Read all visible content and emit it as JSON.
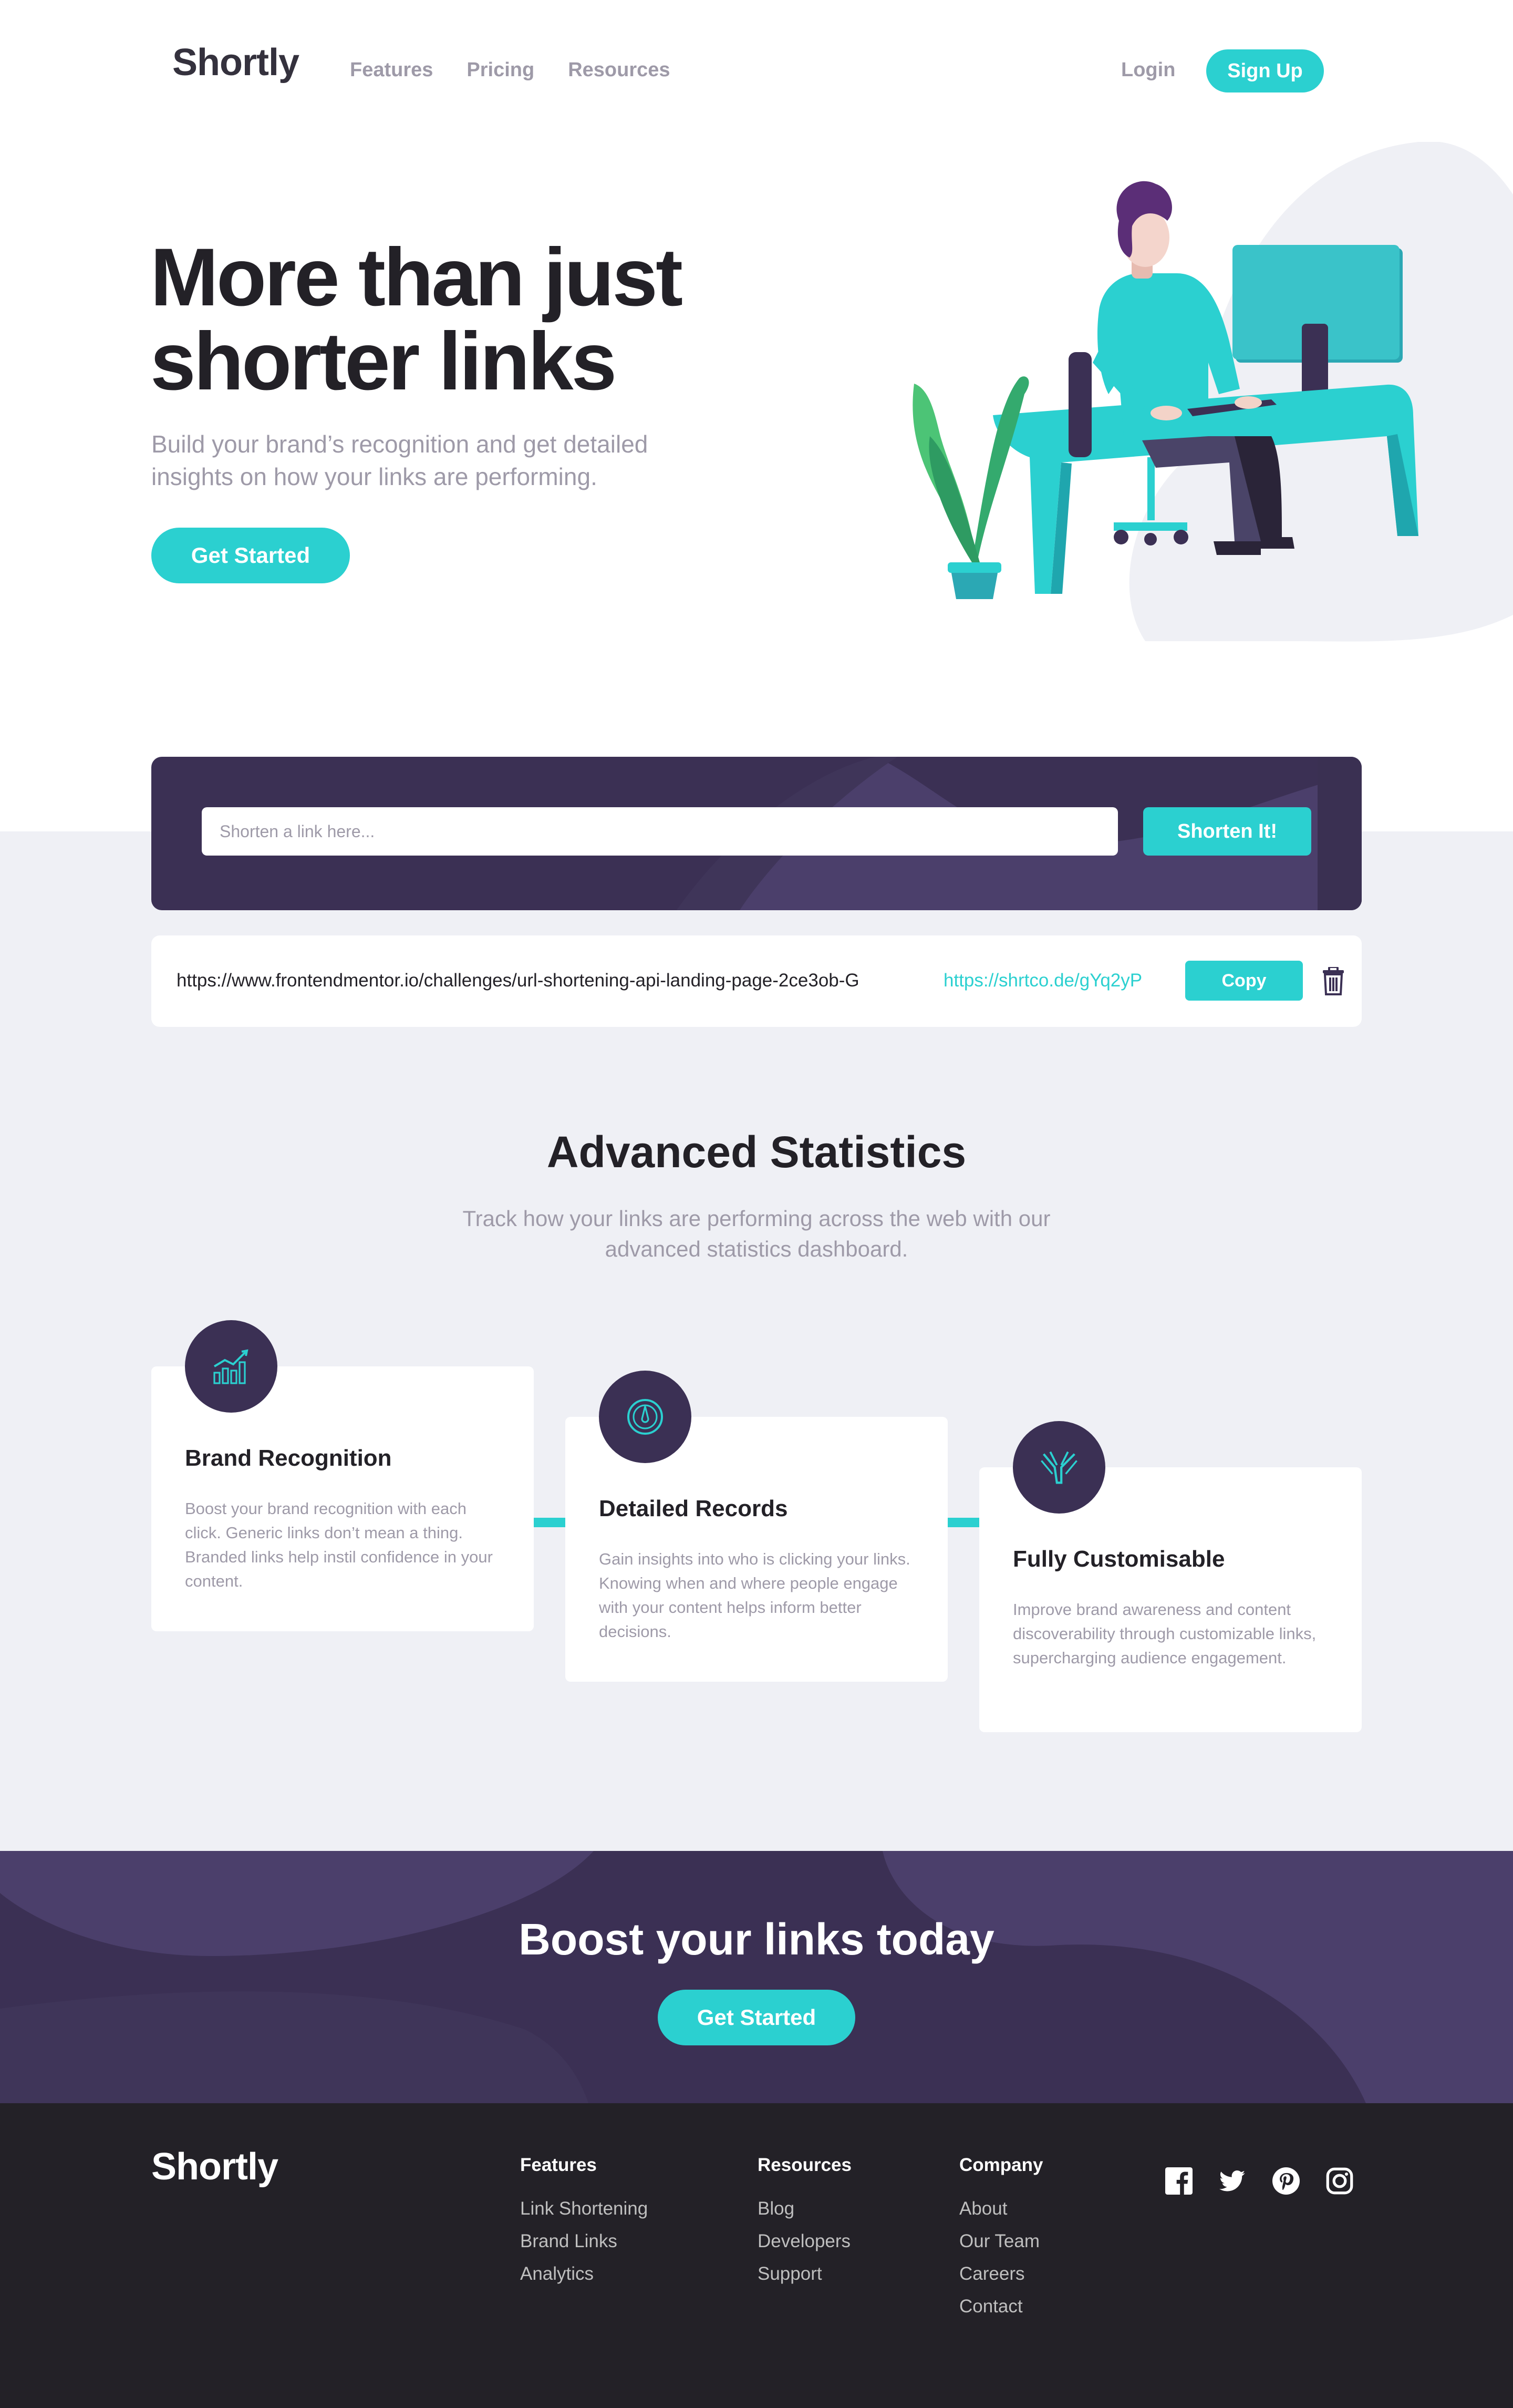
{
  "header": {
    "logo": "Shortly",
    "nav": [
      "Features",
      "Pricing",
      "Resources"
    ],
    "login_label": "Login",
    "signup_label": "Sign Up"
  },
  "hero": {
    "title_line1": "More than just",
    "title_line2": "shorter links",
    "subtitle": "Build your brand’s recognition and get detailed insights on how your links are performing.",
    "cta_label": "Get Started"
  },
  "shorten": {
    "placeholder": "Shorten a link here...",
    "button_label": "Shorten It!"
  },
  "result": {
    "original_url": "https://www.frontendmentor.io/challenges/url-shortening-api-landing-page-2ce3ob-G",
    "short_url": "https://shrtco.de/gYq2yP",
    "copy_label": "Copy"
  },
  "stats": {
    "title": "Advanced Statistics",
    "subtitle": "Track how your links are performing across the web with our advanced statistics dashboard.",
    "cards": [
      {
        "icon": "brand-recognition-chart-icon",
        "title": "Brand Recognition",
        "text": "Boost your brand recognition with each click. Generic links don’t mean a thing. Branded links help instil confidence in your content."
      },
      {
        "icon": "detailed-records-gauge-icon",
        "title": "Detailed Records",
        "text": "Gain insights into who is clicking your links. Knowing when and where people engage with your content helps inform better decisions."
      },
      {
        "icon": "fully-customisable-brushes-icon",
        "title": "Fully Customisable",
        "text": "Improve brand awareness and content discoverability through customizable links, supercharging audience engagement."
      }
    ]
  },
  "boost": {
    "title": "Boost your links today",
    "cta_label": "Get Started"
  },
  "footer": {
    "logo": "Shortly",
    "columns": [
      {
        "heading": "Features",
        "links": [
          "Link Shortening",
          "Brand Links",
          "Analytics"
        ]
      },
      {
        "heading": "Resources",
        "links": [
          "Blog",
          "Developers",
          "Support"
        ]
      },
      {
        "heading": "Company",
        "links": [
          "About",
          "Our Team",
          "Careers",
          "Contact"
        ]
      }
    ],
    "socials": [
      "facebook-icon",
      "twitter-icon",
      "pinterest-icon",
      "instagram-icon"
    ]
  },
  "colors": {
    "cyan": "#2BD0D0",
    "dark_violet": "#3B3054",
    "grey_bg": "#EFF0F5",
    "very_dark": "#232127",
    "grey_text": "#9E9AA8"
  }
}
